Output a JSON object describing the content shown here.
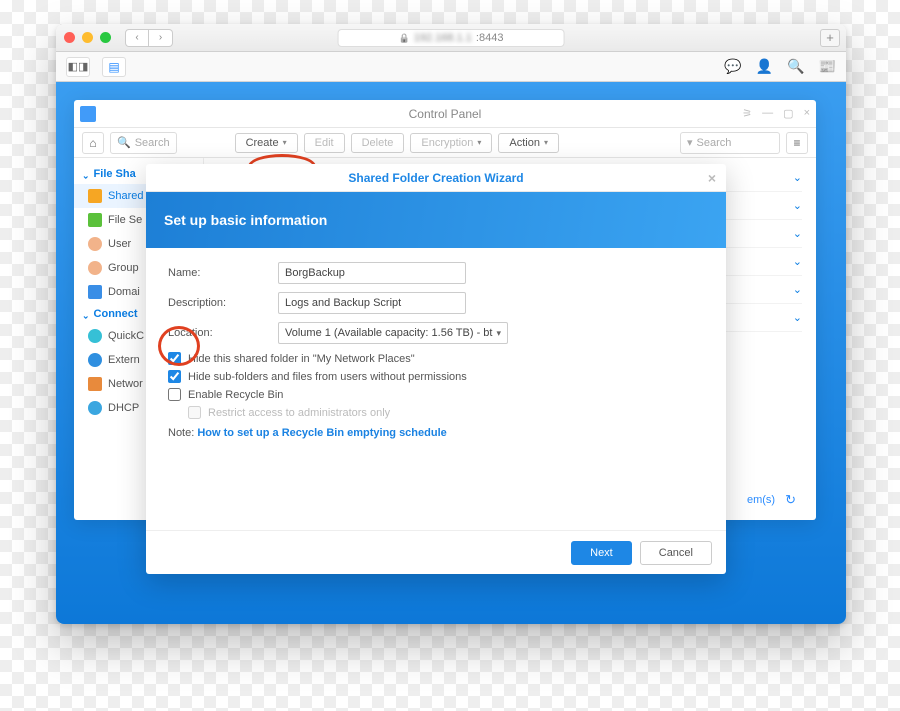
{
  "browser": {
    "address": ":8443",
    "add_tab": "+"
  },
  "dsm_tabs": {
    "right_icons": {
      "chat": "💬",
      "user": "👤",
      "search": "🔍",
      "news": "📰"
    }
  },
  "control_panel": {
    "title": "Control Panel",
    "home_icon": "⌂",
    "search_placeholder": "Search",
    "toolbar": {
      "create": "Create",
      "edit": "Edit",
      "delete": "Delete",
      "encryption": "Encryption",
      "action": "Action",
      "filter_placeholder": "Search"
    },
    "sidebar": {
      "section_file": "File Sha",
      "items_file": [
        {
          "label": "Shared",
          "color": "#f6a623",
          "active": true
        },
        {
          "label": "File Se",
          "color": "#5bc13b"
        },
        {
          "label": "User",
          "color": "#f2b38a"
        },
        {
          "label": "Group",
          "color": "#f2b38a"
        },
        {
          "label": "Domai",
          "color": "#3a8ee6"
        }
      ],
      "section_conn": "Connect",
      "items_conn": [
        {
          "label": "QuickC",
          "color": "#36c0d6"
        },
        {
          "label": "Extern",
          "color": "#2f8fe0"
        },
        {
          "label": "Networ",
          "color": "#e88a3c"
        },
        {
          "label": "DHCP",
          "color": "#3aa6e0"
        }
      ]
    },
    "footer": {
      "items": "em(s)"
    }
  },
  "wizard": {
    "title": "Shared Folder Creation Wizard",
    "banner": "Set up basic information",
    "fields": {
      "name_label": "Name:",
      "name_value": "BorgBackup",
      "desc_label": "Description:",
      "desc_value": "Logs and Backup Script",
      "loc_label": "Location:",
      "loc_value": "Volume 1 (Available capacity: 1.56 TB) - bt"
    },
    "checks": {
      "hide_network": "Hide this shared folder in \"My Network Places\"",
      "hide_sub": "Hide sub-folders and files from users without permissions",
      "recycle": "Enable Recycle Bin",
      "restrict": "Restrict access to administrators only"
    },
    "note_prefix": "Note: ",
    "note_link": "How to set up a Recycle Bin emptying schedule",
    "buttons": {
      "next": "Next",
      "cancel": "Cancel"
    }
  }
}
